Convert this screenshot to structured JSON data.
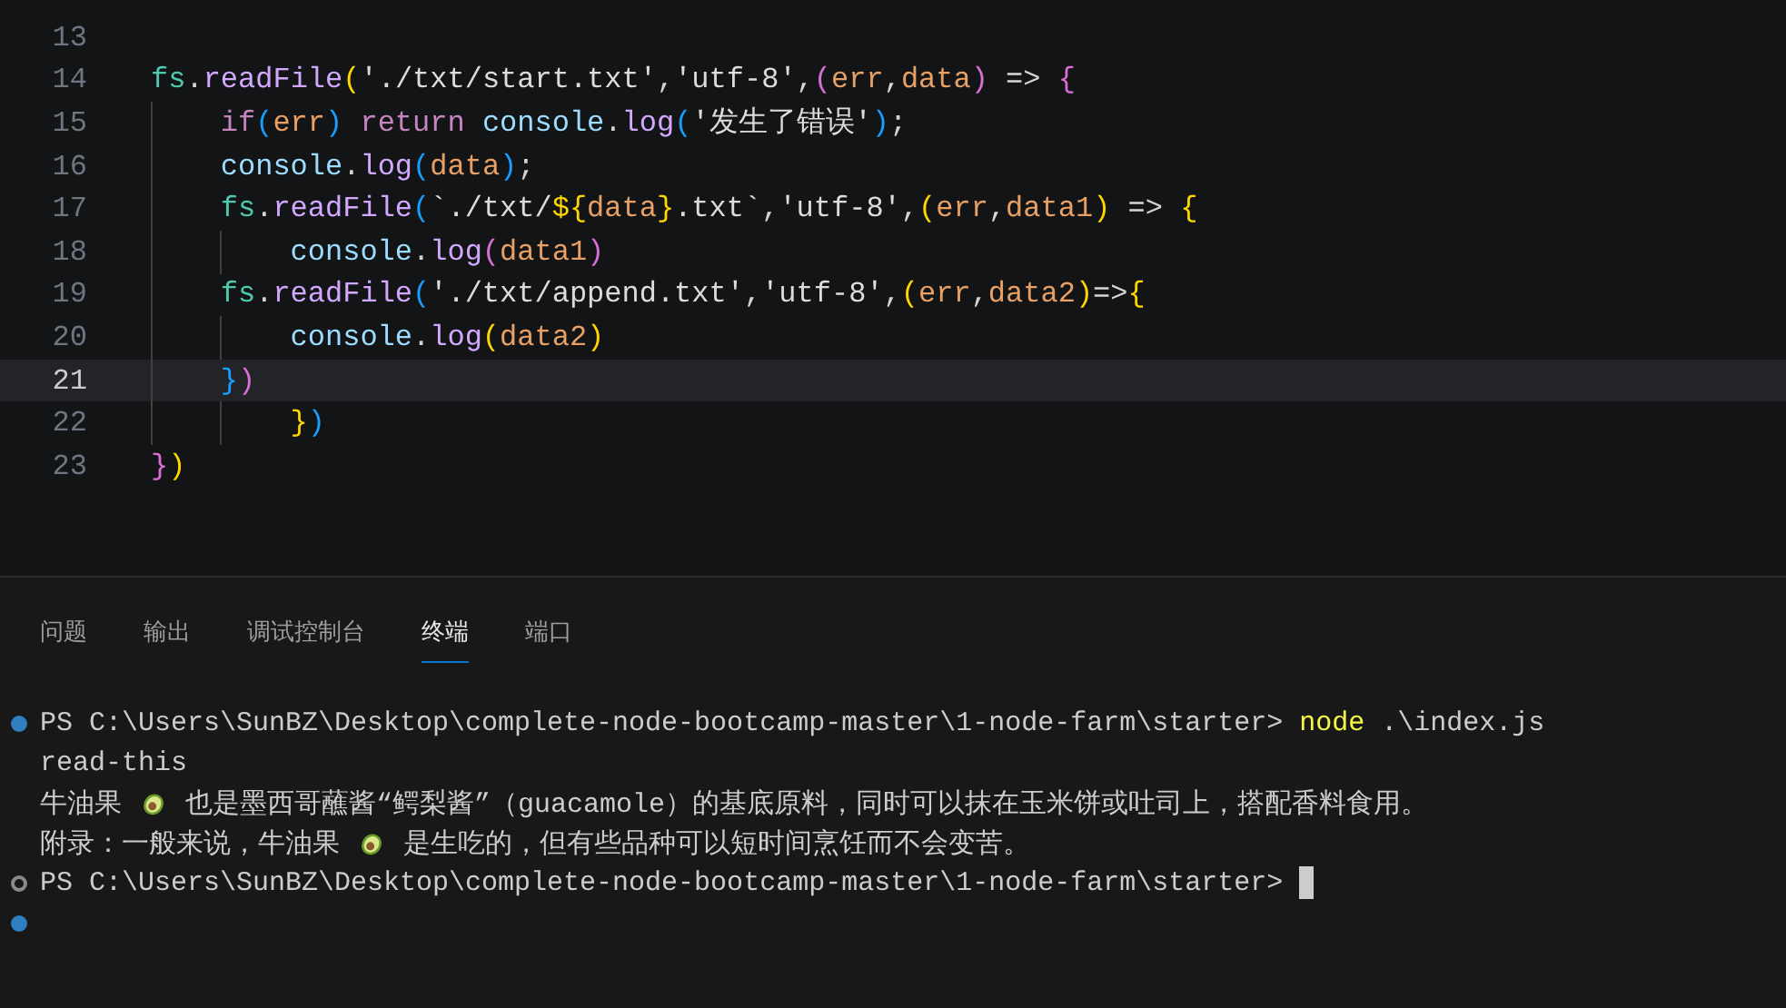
{
  "editor": {
    "lines": [
      {
        "number": "13",
        "current": false
      },
      {
        "number": "14",
        "current": false,
        "tokens": [
          {
            "kind": "obj",
            "text": "fs"
          },
          {
            "kind": "punct",
            "text": "."
          },
          {
            "kind": "fn",
            "text": "readFile"
          },
          {
            "kind": "b1",
            "text": "("
          },
          {
            "kind": "str",
            "text": "'./txt/start.txt'"
          },
          {
            "kind": "punct",
            "text": ","
          },
          {
            "kind": "str",
            "text": "'utf-8'"
          },
          {
            "kind": "punct",
            "text": ","
          },
          {
            "kind": "b2",
            "text": "("
          },
          {
            "kind": "param",
            "text": "err"
          },
          {
            "kind": "punct",
            "text": ","
          },
          {
            "kind": "param",
            "text": "data"
          },
          {
            "kind": "b2",
            "text": ")"
          },
          {
            "kind": "punct",
            "text": " => "
          },
          {
            "kind": "b2",
            "text": "{"
          }
        ]
      },
      {
        "number": "15",
        "current": false,
        "tokens": [
          {
            "kind": "kw",
            "text": "    if"
          },
          {
            "kind": "b3",
            "text": "("
          },
          {
            "kind": "param",
            "text": "err"
          },
          {
            "kind": "b3",
            "text": ")"
          },
          {
            "kind": "kw",
            "text": " return "
          },
          {
            "kind": "var",
            "text": "console"
          },
          {
            "kind": "punct",
            "text": "."
          },
          {
            "kind": "fn",
            "text": "log"
          },
          {
            "kind": "b3",
            "text": "("
          },
          {
            "kind": "str",
            "text": "'发生了错误'"
          },
          {
            "kind": "b3",
            "text": ")"
          },
          {
            "kind": "punct",
            "text": ";"
          }
        ]
      },
      {
        "number": "16",
        "current": false,
        "tokens": [
          {
            "kind": "var",
            "text": "    console"
          },
          {
            "kind": "punct",
            "text": "."
          },
          {
            "kind": "fn",
            "text": "log"
          },
          {
            "kind": "b3",
            "text": "("
          },
          {
            "kind": "param",
            "text": "data"
          },
          {
            "kind": "b3",
            "text": ")"
          },
          {
            "kind": "punct",
            "text": ";"
          }
        ]
      },
      {
        "number": "17",
        "current": false,
        "tokens": [
          {
            "kind": "obj",
            "text": "    fs"
          },
          {
            "kind": "punct",
            "text": "."
          },
          {
            "kind": "fn",
            "text": "readFile"
          },
          {
            "kind": "b3",
            "text": "("
          },
          {
            "kind": "str",
            "text": "`./txt/"
          },
          {
            "kind": "b1",
            "text": "${"
          },
          {
            "kind": "param",
            "text": "data"
          },
          {
            "kind": "b1",
            "text": "}"
          },
          {
            "kind": "str",
            "text": ".txt`"
          },
          {
            "kind": "punct",
            "text": ","
          },
          {
            "kind": "str",
            "text": "'utf-8'"
          },
          {
            "kind": "punct",
            "text": ","
          },
          {
            "kind": "b1",
            "text": "("
          },
          {
            "kind": "param",
            "text": "err"
          },
          {
            "kind": "punct",
            "text": ","
          },
          {
            "kind": "param",
            "text": "data1"
          },
          {
            "kind": "b1",
            "text": ")"
          },
          {
            "kind": "punct",
            "text": " => "
          },
          {
            "kind": "b1",
            "text": "{"
          }
        ]
      },
      {
        "number": "18",
        "current": false,
        "tokens": [
          {
            "kind": "var",
            "text": "        console"
          },
          {
            "kind": "punct",
            "text": "."
          },
          {
            "kind": "fn",
            "text": "log"
          },
          {
            "kind": "b2",
            "text": "("
          },
          {
            "kind": "param",
            "text": "data1"
          },
          {
            "kind": "b2",
            "text": ")"
          }
        ]
      },
      {
        "number": "19",
        "current": false,
        "tokens": [
          {
            "kind": "obj",
            "text": "    fs"
          },
          {
            "kind": "punct",
            "text": "."
          },
          {
            "kind": "fn",
            "text": "readFile"
          },
          {
            "kind": "b3",
            "text": "("
          },
          {
            "kind": "str",
            "text": "'./txt/append.txt'"
          },
          {
            "kind": "punct",
            "text": ","
          },
          {
            "kind": "str",
            "text": "'utf-8'"
          },
          {
            "kind": "punct",
            "text": ","
          },
          {
            "kind": "b1",
            "text": "("
          },
          {
            "kind": "param",
            "text": "err"
          },
          {
            "kind": "punct",
            "text": ","
          },
          {
            "kind": "param",
            "text": "data2"
          },
          {
            "kind": "b1",
            "text": ")"
          },
          {
            "kind": "punct",
            "text": "=>"
          },
          {
            "kind": "b1",
            "text": "{"
          }
        ]
      },
      {
        "number": "20",
        "current": false,
        "tokens": [
          {
            "kind": "var",
            "text": "        console"
          },
          {
            "kind": "punct",
            "text": "."
          },
          {
            "kind": "fn",
            "text": "log"
          },
          {
            "kind": "b1",
            "text": "("
          },
          {
            "kind": "param",
            "text": "data2"
          },
          {
            "kind": "b1",
            "text": ")"
          }
        ]
      },
      {
        "number": "21",
        "current": true,
        "tokens": [
          {
            "kind": "b3",
            "text": "    }"
          },
          {
            "kind": "b2",
            "text": ")"
          }
        ]
      },
      {
        "number": "22",
        "current": false,
        "tokens": [
          {
            "kind": "b1",
            "text": "        }"
          },
          {
            "kind": "b3",
            "text": ")"
          }
        ]
      },
      {
        "number": "23",
        "current": false,
        "tokens": [
          {
            "kind": "b2",
            "text": "}"
          },
          {
            "kind": "b1",
            "text": ")"
          }
        ]
      }
    ]
  },
  "panel": {
    "tabs": [
      {
        "label": "问题",
        "selected": false
      },
      {
        "label": "输出",
        "selected": false
      },
      {
        "label": "调试控制台",
        "selected": false
      },
      {
        "label": "终端",
        "selected": true
      },
      {
        "label": "端口",
        "selected": false
      }
    ]
  },
  "terminal": {
    "lines": [
      {
        "kind": "prompt",
        "succeeded": true,
        "prompt": "PS C:\\Users\\SunBZ\\Desktop\\complete-node-bootcamp-master\\1-node-farm\\starter>",
        "command": "node",
        "args": ".\\index.js",
        "cursor": false
      },
      {
        "kind": "output",
        "segments": [
          {
            "kind": "text",
            "text": "read-this"
          }
        ]
      },
      {
        "kind": "output",
        "segments": [
          {
            "kind": "text",
            "text": "牛油果 "
          },
          {
            "kind": "avocado"
          },
          {
            "kind": "text",
            "text": " 也是墨西哥蘸酱“鳄梨酱”（guacamole）的基底原料，同时可以抹在玉米饼或吐司上，搭配香料食用。"
          }
        ]
      },
      {
        "kind": "output",
        "segments": [
          {
            "kind": "text",
            "text": "附录：一般来说，牛油果 "
          },
          {
            "kind": "avocado"
          },
          {
            "kind": "text",
            "text": " 是生吃的，但有些品种可以短时间烹饪而不会变苦。"
          }
        ]
      },
      {
        "kind": "prompt",
        "succeeded": false,
        "prompt": "PS C:\\Users\\SunBZ\\Desktop\\complete-node-bootcamp-master\\1-node-farm\\starter>",
        "cursor": true
      },
      {
        "kind": "blank",
        "succeeded": true
      }
    ]
  }
}
